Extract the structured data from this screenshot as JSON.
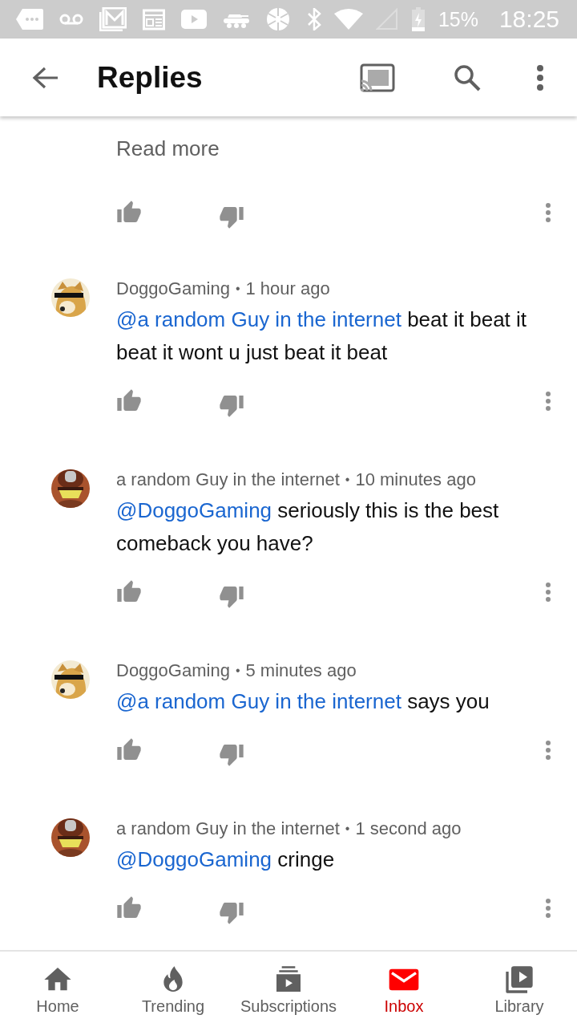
{
  "status_bar": {
    "battery": "15%",
    "time": "18:25"
  },
  "header": {
    "title": "Replies"
  },
  "read_more": "Read more",
  "comments": [
    {
      "author": "DoggoGaming",
      "separator": "•",
      "time": "1 hour ago",
      "mention": "@a random Guy in the internet",
      "text": "beat it beat it beat it wont u just beat it beat"
    },
    {
      "author": "a random Guy in the internet",
      "separator": "•",
      "time": "10 minutes ago",
      "mention": "@DoggoGaming",
      "text": "seriously this is the best comeback you have?"
    },
    {
      "author": "DoggoGaming",
      "separator": "•",
      "time": "5 minutes ago",
      "mention": "@a random Guy in the internet",
      "text": "says you"
    },
    {
      "author": "a random Guy in the internet",
      "separator": "•",
      "time": "1 second ago",
      "mention": "@DoggoGaming",
      "text": "cringe"
    }
  ],
  "bottom_nav": [
    {
      "label": "Home",
      "selected": false
    },
    {
      "label": "Trending",
      "selected": false
    },
    {
      "label": "Subscriptions",
      "selected": false
    },
    {
      "label": "Inbox",
      "selected": true
    },
    {
      "label": "Library",
      "selected": false
    }
  ]
}
